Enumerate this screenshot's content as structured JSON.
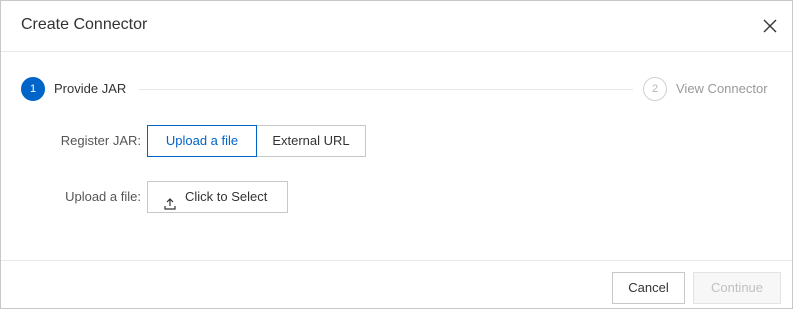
{
  "dialog": {
    "title": "Create Connector",
    "close_icon": "close-icon"
  },
  "steps": [
    {
      "number": "1",
      "label": "Provide JAR",
      "status": "active"
    },
    {
      "number": "2",
      "label": "View Connector",
      "status": "pending"
    }
  ],
  "form": {
    "register_label": "Register JAR",
    "register_options": [
      {
        "label": "Upload a file",
        "selected": true
      },
      {
        "label": "External URL",
        "selected": false
      }
    ],
    "upload_label": "Upload a file",
    "label_separator": ":",
    "select_button_label": "Click to Select",
    "select_button_icon": "upload-icon"
  },
  "footer": {
    "cancel_label": "Cancel",
    "continue_label": "Continue",
    "continue_disabled": true
  },
  "colors": {
    "accent": "#0064c8",
    "border": "#c8c8c8",
    "disabled_text": "#c0c0c0"
  }
}
